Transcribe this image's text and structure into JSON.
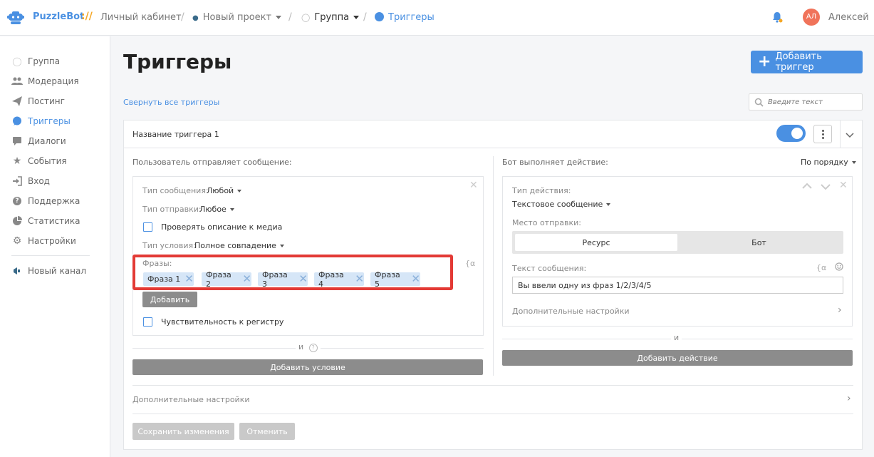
{
  "app": {
    "brand": "PuzzleBot",
    "brand_slash": "://",
    "accent": "#4a90e2",
    "highlight": "#e33a35"
  },
  "breadcrumb": [
    {
      "label": "Личный кабинет"
    },
    {
      "label": "Новый проект"
    },
    {
      "label": "Группа"
    },
    {
      "label": "Триггеры"
    }
  ],
  "user": {
    "initials": "АЛ",
    "name": "Алексей"
  },
  "sidebar": {
    "items": [
      {
        "label": "Группа",
        "icon": "chat-bubble-icon"
      },
      {
        "label": "Модерация",
        "icon": "users-icon"
      },
      {
        "label": "Постинг",
        "icon": "paper-plane-icon"
      },
      {
        "label": "Триггеры",
        "icon": "chat-bubble-icon",
        "active": true
      },
      {
        "label": "Диалоги",
        "icon": "message-icon"
      },
      {
        "label": "События",
        "icon": "star-icon"
      },
      {
        "label": "Вход",
        "icon": "sign-in-icon"
      },
      {
        "label": "Поддержка",
        "icon": "question-icon"
      },
      {
        "label": "Статистика",
        "icon": "pie-chart-icon"
      },
      {
        "label": "Настройки",
        "icon": "gear-icon"
      }
    ],
    "new_channel": "Новый канал"
  },
  "page": {
    "title": "Триггеры",
    "add_button": "Добавить триггер",
    "collapse_all": "Свернуть все триггеры",
    "search_placeholder": "Введите текст"
  },
  "trigger": {
    "name": "Название триггера 1",
    "enabled": true,
    "conditions": {
      "heading": "Пользователь отправляет сообщение:",
      "message_type_label": "Тип сообщения:",
      "message_type_value": "Любой",
      "send_type_label": "Тип отправки:",
      "send_type_value": "Любое",
      "check_media_label": "Проверять описание к медиа",
      "condition_type_label": "Тип условия:",
      "condition_type_value": "Полное совпадение",
      "phrases_label": "Фразы:",
      "phrases_var_icon": "{α",
      "phrases": [
        "Фраза 1",
        "Фраза 2",
        "Фраза 3",
        "Фраза 4",
        "Фраза 5"
      ],
      "add_phrase": "Добавить",
      "case_sensitive_label": "Чувствительность к регистру",
      "and_label": "и",
      "help_icon": "?",
      "add_condition": "Добавить условие"
    },
    "actions": {
      "heading": "Бот выполняет действие:",
      "order_label": "По порядку",
      "action_type_label": "Тип действия:",
      "action_type_value": "Текстовое сообщение",
      "send_place_label": "Место отправки:",
      "send_place_options": [
        "Ресурс",
        "Бот"
      ],
      "send_place_selected": "Ресурс",
      "message_text_label": "Текст сообщения:",
      "message_var_icon": "{α",
      "message_text": "Вы ввели одну из фраз 1/2/3/4/5",
      "extra_settings": "Дополнительные настройки",
      "and_label": "и",
      "add_action": "Добавить действие"
    },
    "extra_settings": "Дополнительные настройки",
    "save": "Сохранить изменения",
    "cancel": "Отменить"
  }
}
